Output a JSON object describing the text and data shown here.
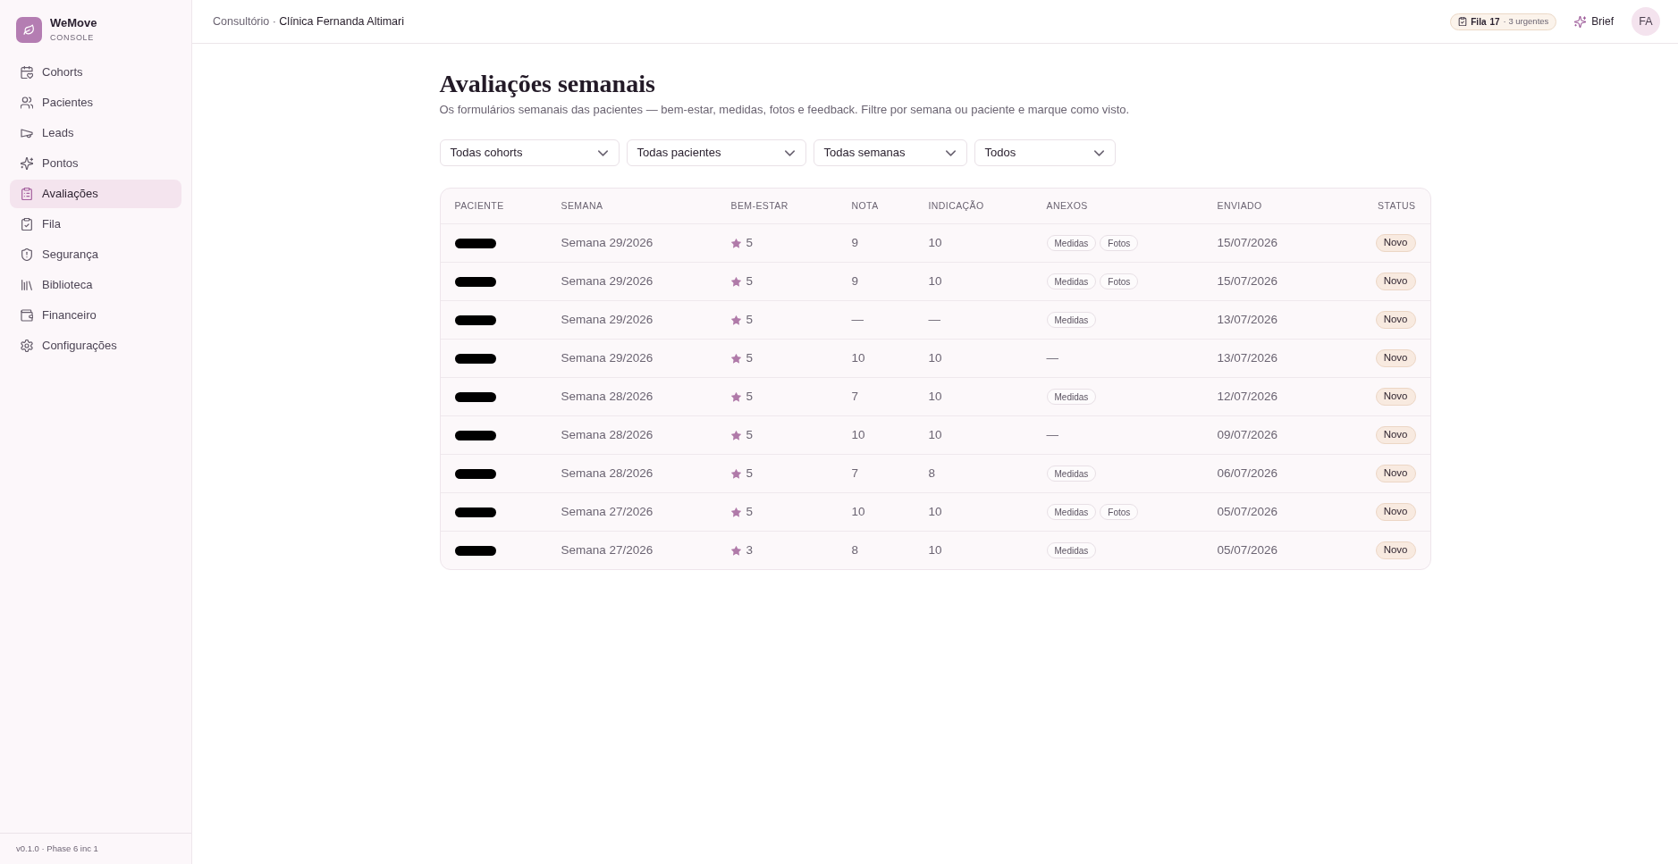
{
  "sidebar": {
    "brand": {
      "name": "WeMove",
      "subtitle": "CONSOLE"
    },
    "items": [
      {
        "label": "Cohorts",
        "selected": false
      },
      {
        "label": "Pacientes",
        "selected": false
      },
      {
        "label": "Leads",
        "selected": false
      },
      {
        "label": "Pontos",
        "selected": false
      },
      {
        "label": "Avaliações",
        "selected": true
      },
      {
        "label": "Fila",
        "selected": false
      },
      {
        "label": "Segurança",
        "selected": false
      },
      {
        "label": "Biblioteca",
        "selected": false
      },
      {
        "label": "Financeiro",
        "selected": false
      },
      {
        "label": "Configurações",
        "selected": false
      }
    ],
    "footer": "v0.1.0 · Phase 6 inc 1"
  },
  "header": {
    "breadcrumb": {
      "parent": "Consultório",
      "separator": "·",
      "current": "Clínica Fernanda Altimari"
    },
    "queue": {
      "label": "Fila",
      "count": "17",
      "note": "· 3 urgentes"
    },
    "brief": {
      "label": "Brief"
    },
    "avatar": {
      "initials": "FA"
    }
  },
  "page": {
    "title": "Avaliações semanais",
    "description": "Os formulários semanais das pacientes — bem-estar, medidas, fotos e feedback. Filtre por semana ou paciente e marque como visto."
  },
  "filters": [
    {
      "value": "Todas cohorts"
    },
    {
      "value": "Todas pacientes"
    },
    {
      "value": "Todas semanas"
    },
    {
      "value": "Todos"
    }
  ],
  "table": {
    "columns": [
      "PACIENTE",
      "SEMANA",
      "BEM-ESTAR",
      "NOTA",
      "INDICAÇÃO",
      "ANEXOS",
      "ENVIADO",
      "STATUS"
    ],
    "rows": [
      {
        "patient_redacted": true,
        "week": "Semana 29/2026",
        "wellbeing": "5",
        "score": "9",
        "referral": "10",
        "attachments": [
          "Medidas",
          "Fotos"
        ],
        "sent": "15/07/2026",
        "status": "Novo"
      },
      {
        "patient_redacted": true,
        "week": "Semana 29/2026",
        "wellbeing": "5",
        "score": "9",
        "referral": "10",
        "attachments": [
          "Medidas",
          "Fotos"
        ],
        "sent": "15/07/2026",
        "status": "Novo"
      },
      {
        "patient_redacted": true,
        "week": "Semana 29/2026",
        "wellbeing": "5",
        "score": "—",
        "referral": "—",
        "attachments": [
          "Medidas"
        ],
        "sent": "13/07/2026",
        "status": "Novo"
      },
      {
        "patient_redacted": true,
        "week": "Semana 29/2026",
        "wellbeing": "5",
        "score": "10",
        "referral": "10",
        "attachments_text": "—",
        "sent": "13/07/2026",
        "status": "Novo"
      },
      {
        "patient_redacted": true,
        "week": "Semana 28/2026",
        "wellbeing": "5",
        "score": "7",
        "referral": "10",
        "attachments": [
          "Medidas"
        ],
        "sent": "12/07/2026",
        "status": "Novo"
      },
      {
        "patient_redacted": true,
        "week": "Semana 28/2026",
        "wellbeing": "5",
        "score": "10",
        "referral": "10",
        "attachments_text": "—",
        "sent": "09/07/2026",
        "status": "Novo"
      },
      {
        "patient_redacted": true,
        "week": "Semana 28/2026",
        "wellbeing": "5",
        "score": "7",
        "referral": "8",
        "attachments": [
          "Medidas"
        ],
        "sent": "06/07/2026",
        "status": "Novo"
      },
      {
        "patient_redacted": true,
        "week": "Semana 27/2026",
        "wellbeing": "5",
        "score": "10",
        "referral": "10",
        "attachments": [
          "Medidas",
          "Fotos"
        ],
        "sent": "05/07/2026",
        "status": "Novo"
      },
      {
        "patient_redacted": true,
        "week": "Semana 27/2026",
        "wellbeing": "3",
        "score": "8",
        "referral": "10",
        "attachments": [
          "Medidas"
        ],
        "sent": "05/07/2026",
        "status": "Novo"
      }
    ]
  }
}
